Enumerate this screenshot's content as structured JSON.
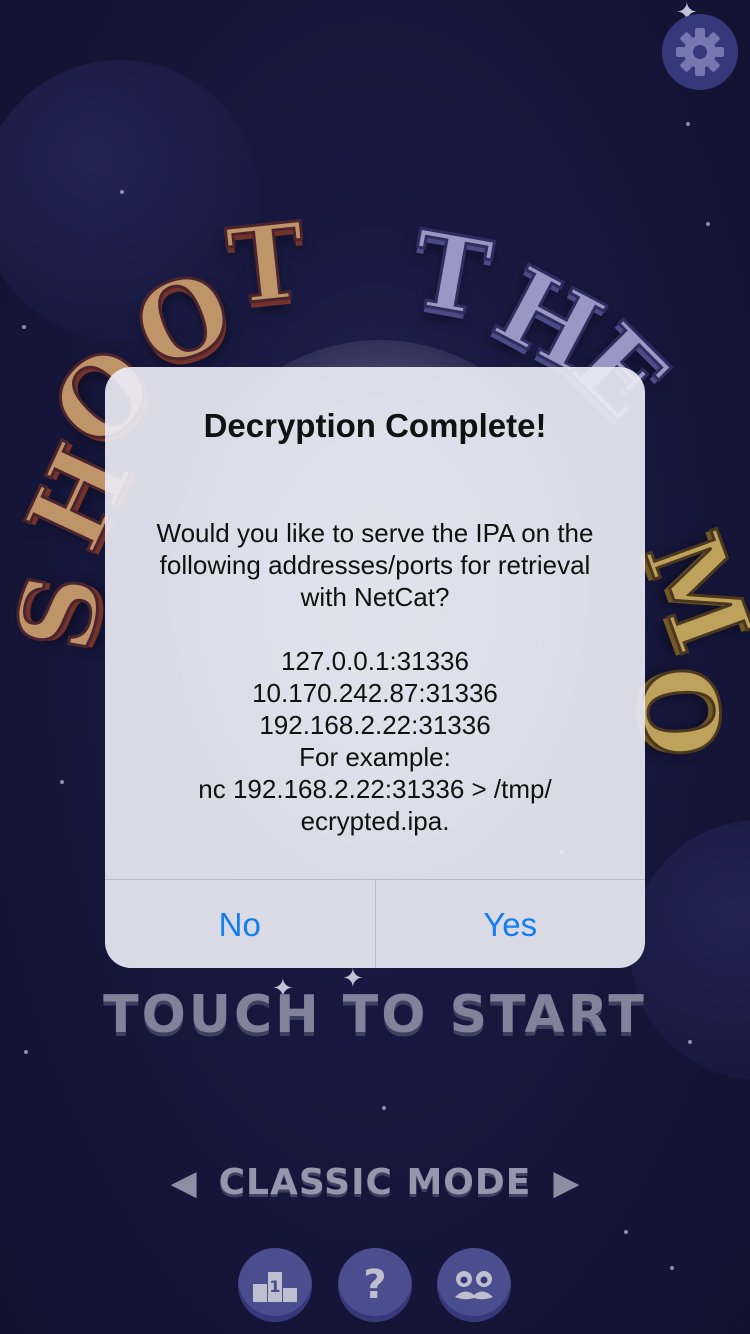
{
  "game": {
    "title_letters": [
      "S",
      "H",
      "O",
      "O",
      "T",
      "T",
      "H",
      "E",
      "M",
      "O"
    ],
    "touch_to_start": "TOUCH TO START",
    "mode": {
      "label": "CLASSIC MODE",
      "prev_icon": "triangle-left-icon",
      "next_icon": "triangle-right-icon"
    },
    "bottom_buttons": [
      {
        "name": "leaderboard-button",
        "icon": "podium-icon",
        "glyph": "1"
      },
      {
        "name": "help-button",
        "icon": "question-icon",
        "glyph": "?"
      },
      {
        "name": "character-button",
        "icon": "mustache-face-icon",
        "glyph": ""
      }
    ],
    "settings_icon": "gear-icon"
  },
  "alert": {
    "title": "Decryption Complete!",
    "message_intro": [
      "Would you like to serve the IPA on the",
      "following addresses/ports for retrieval",
      "with NetCat?"
    ],
    "addresses": [
      "127.0.0.1:31336",
      "10.170.242.87:31336",
      "192.168.2.22:31336"
    ],
    "example_label": "For example:",
    "example_command": [
      "nc 192.168.2.22:31336 > /tmp/",
      "ecrypted.ipa."
    ],
    "buttons": {
      "no": "No",
      "yes": "Yes"
    }
  },
  "colors": {
    "background": "#14163a",
    "alert_background": "#ecebf5",
    "button_text": "#127ef0",
    "title_orange": "#e8b27a",
    "title_blue": "#b9b7ea",
    "title_gold": "#e6c46a"
  }
}
